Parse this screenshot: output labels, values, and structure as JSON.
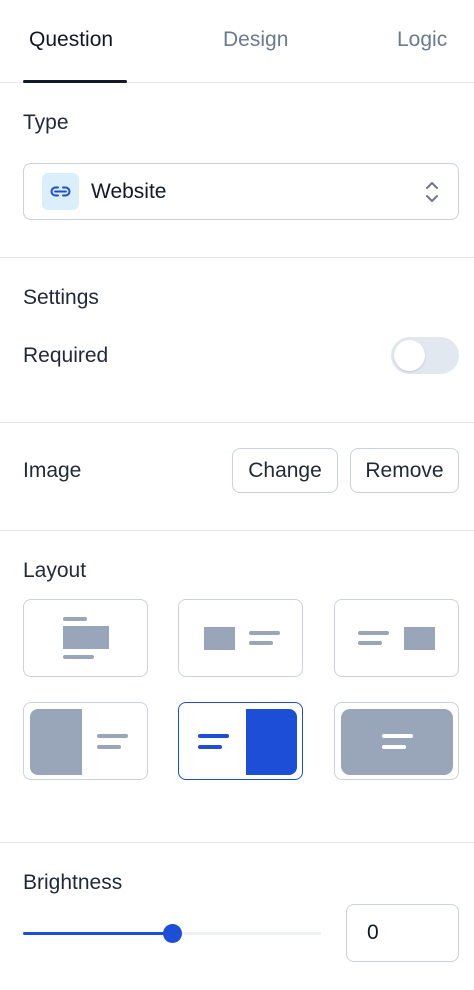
{
  "tabs": [
    {
      "label": "Question",
      "active": true
    },
    {
      "label": "Design",
      "active": false
    },
    {
      "label": "Logic",
      "active": false
    }
  ],
  "type": {
    "label": "Type",
    "selected": "Website",
    "icon": "link-icon"
  },
  "settings": {
    "label": "Settings",
    "required_label": "Required",
    "required": false
  },
  "image": {
    "label": "Image",
    "change_label": "Change",
    "remove_label": "Remove"
  },
  "layout": {
    "label": "Layout",
    "options": [
      "media-top",
      "media-left",
      "media-right",
      "split-left",
      "split-right",
      "background"
    ],
    "selected_index": 4
  },
  "brightness": {
    "label": "Brightness",
    "value": "0",
    "slider_fraction": 0.5
  },
  "colors": {
    "accent": "#1d4ed8",
    "muted_block": "#99a5b8",
    "icon_bg": "#dbeefb"
  }
}
